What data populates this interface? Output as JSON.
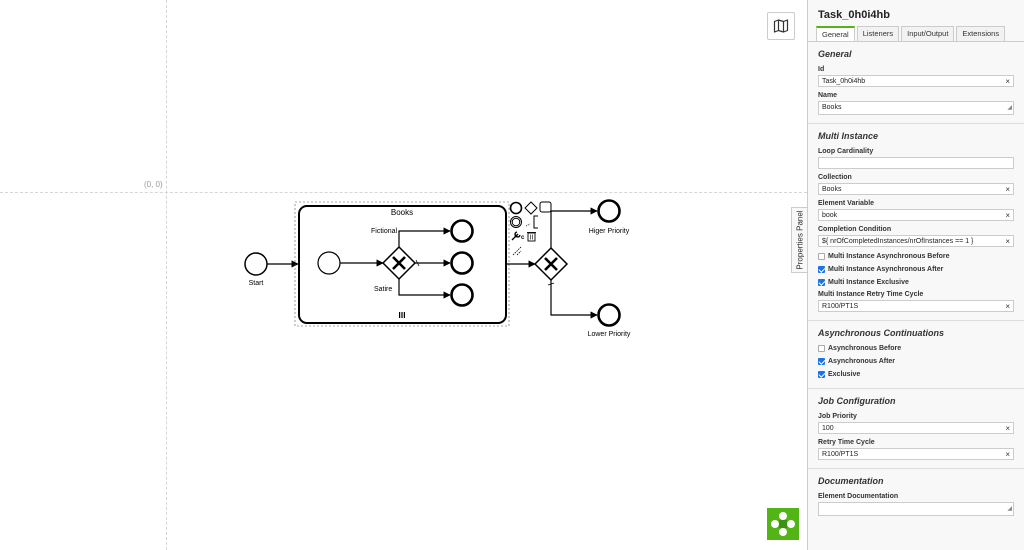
{
  "canvas": {
    "origin_label": "(0, 0)",
    "toggle_label": "Properties Panel",
    "diagram": {
      "start_label": "Start",
      "subprocess_label": "Books",
      "fictional_label": "Fictional",
      "satire_label": "Satire",
      "higher_priority_label": "Higer Priority",
      "lower_priority_label": "Lower Priority"
    }
  },
  "panel": {
    "title": "Task_0h0i4hb",
    "tabs": [
      {
        "label": "General"
      },
      {
        "label": "Listeners"
      },
      {
        "label": "Input/Output"
      },
      {
        "label": "Extensions"
      }
    ],
    "general": {
      "title": "General",
      "id_label": "Id",
      "id_value": "Task_0h0i4hb",
      "name_label": "Name",
      "name_value": "Books"
    },
    "multi_instance": {
      "title": "Multi Instance",
      "loop_label": "Loop Cardinality",
      "loop_value": "",
      "collection_label": "Collection",
      "collection_value": "Books",
      "element_variable_label": "Element Variable",
      "element_variable_value": "book",
      "completion_label": "Completion Condition",
      "completion_value": "${ nrOfCompletedInstances/nrOfInstances == 1 }",
      "async_before_label": "Multi Instance Asynchronous Before",
      "async_before_checked": false,
      "async_after_label": "Multi Instance Asynchronous After",
      "async_after_checked": true,
      "exclusive_label": "Multi Instance Exclusive",
      "exclusive_checked": true,
      "retry_label": "Multi Instance Retry Time Cycle",
      "retry_value": "R100/PT1S"
    },
    "async_continuations": {
      "title": "Asynchronous Continuations",
      "before_label": "Asynchronous Before",
      "before_checked": false,
      "after_label": "Asynchronous After",
      "after_checked": true,
      "exclusive_label": "Exclusive",
      "exclusive_checked": true
    },
    "job_configuration": {
      "title": "Job Configuration",
      "priority_label": "Job Priority",
      "priority_value": "100",
      "retry_label": "Retry Time Cycle",
      "retry_value": "R100/PT1S"
    },
    "documentation": {
      "title": "Documentation",
      "element_doc_label": "Element Documentation",
      "element_doc_value": ""
    },
    "clear_symbol": "×",
    "accent_color": "#52b415",
    "checkbox_color": "#1a73e8"
  }
}
